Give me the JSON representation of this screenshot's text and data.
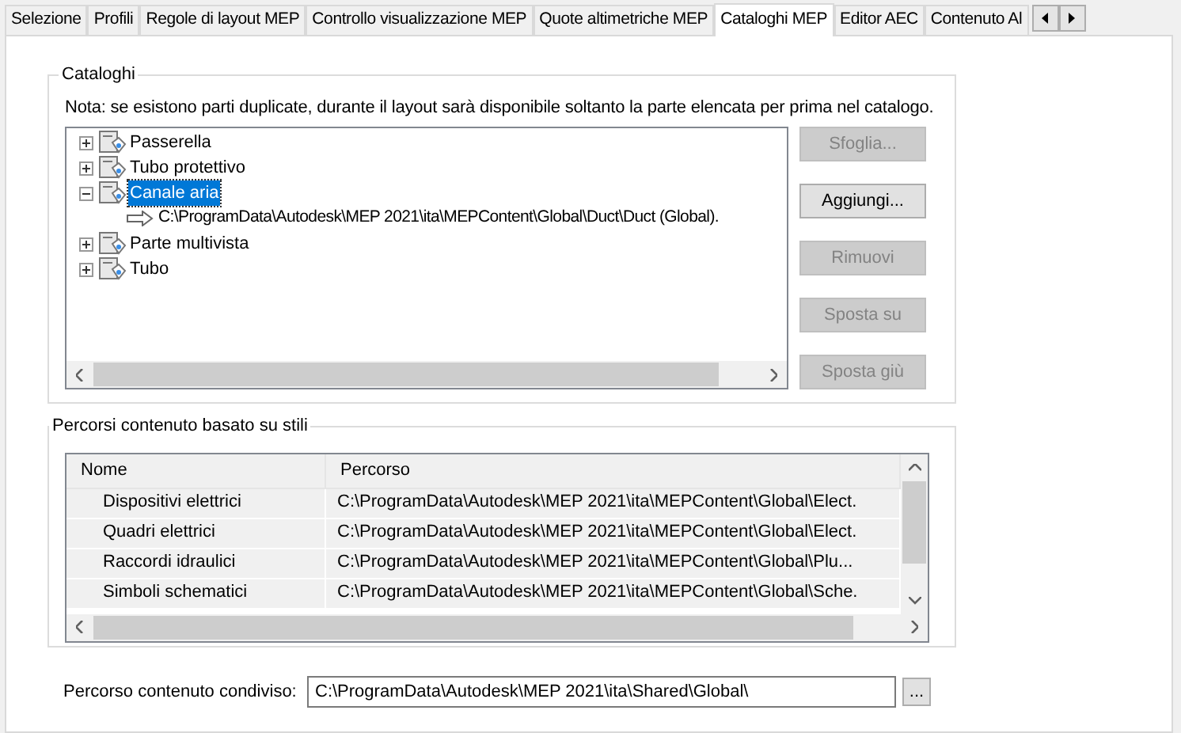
{
  "tabs": [
    {
      "label": "Selezione",
      "selected": false
    },
    {
      "label": "Profili",
      "selected": false
    },
    {
      "label": "Regole di layout MEP",
      "selected": false
    },
    {
      "label": "Controllo visualizzazione MEP",
      "selected": false
    },
    {
      "label": "Quote altimetriche MEP",
      "selected": false
    },
    {
      "label": "Cataloghi MEP",
      "selected": true
    },
    {
      "label": "Editor AEC",
      "selected": false
    },
    {
      "label": "Contenuto Al",
      "selected": false
    }
  ],
  "catalogs": {
    "title": "Cataloghi",
    "note": "Nota: se esistono parti duplicate, durante il layout sarà disponibile soltanto la parte elencata per prima nel catalogo.",
    "tree": [
      {
        "label": "Passerella",
        "expanded": false,
        "selected": false
      },
      {
        "label": "Tubo protettivo",
        "expanded": false,
        "selected": false
      },
      {
        "label": "Canale aria",
        "expanded": true,
        "selected": true,
        "children": [
          {
            "label": "C:\\ProgramData\\Autodesk\\MEP 2021\\ita\\MEPContent\\Global\\Duct\\Duct (Global)."
          }
        ]
      },
      {
        "label": "Parte multivista",
        "expanded": false,
        "selected": false
      },
      {
        "label": "Tubo",
        "expanded": false,
        "selected": false
      }
    ],
    "buttons": [
      {
        "label": "Sfoglia...",
        "disabled": true
      },
      {
        "label": "Aggiungi...",
        "disabled": false
      },
      {
        "label": "Rimuovi",
        "disabled": true
      },
      {
        "label": "Sposta su",
        "disabled": true
      },
      {
        "label": "Sposta giù",
        "disabled": true
      }
    ]
  },
  "style_paths": {
    "title": "Percorsi contenuto basato su stili",
    "columns": [
      "Nome",
      "Percorso"
    ],
    "rows": [
      [
        "Dispositivi elettrici",
        "C:\\ProgramData\\Autodesk\\MEP 2021\\ita\\MEPContent\\Global\\Elect."
      ],
      [
        "Quadri elettrici",
        "C:\\ProgramData\\Autodesk\\MEP 2021\\ita\\MEPContent\\Global\\Elect."
      ],
      [
        "Raccordi idraulici",
        "C:\\ProgramData\\Autodesk\\MEP 2021\\ita\\MEPContent\\Global\\Plu..."
      ],
      [
        "Simboli schematici",
        "C:\\ProgramData\\Autodesk\\MEP 2021\\ita\\MEPContent\\Global\\Sche."
      ]
    ]
  },
  "shared": {
    "label": "Percorso contenuto condiviso:",
    "value": "C:\\ProgramData\\Autodesk\\MEP 2021\\ita\\Shared\\Global\\",
    "browse": "..."
  }
}
